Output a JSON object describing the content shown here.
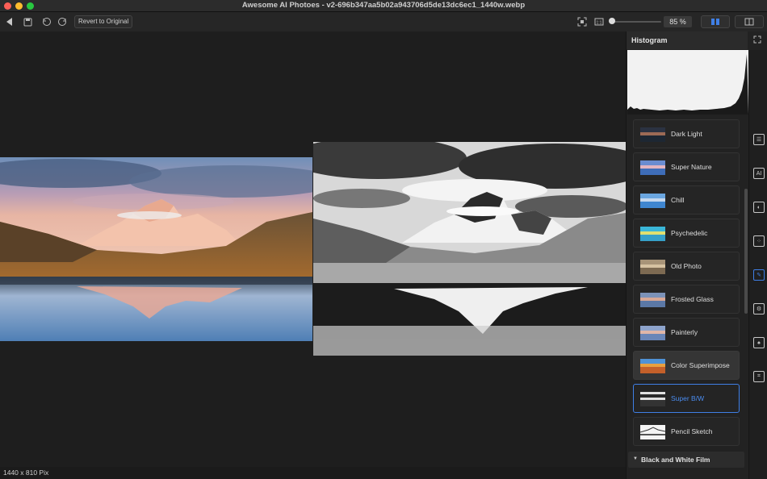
{
  "window": {
    "title": "Awesome AI Photoes   - v2-696b347aa5b02a943706d5de13dc6ec1_1440w.webp"
  },
  "toolbar": {
    "revert_label": "Revert to Original",
    "zoom_value": "85 %",
    "zoom_level": 0.85
  },
  "status": {
    "dimensions": "1440 x 810 Pix"
  },
  "histogram": {
    "title": "Histogram"
  },
  "presets": [
    {
      "label": "Dark Light",
      "icon": "thumb-dark-light"
    },
    {
      "label": "Super Nature",
      "icon": "thumb-super-nature"
    },
    {
      "label": "Chill",
      "icon": "thumb-chill"
    },
    {
      "label": "Psychedelic",
      "icon": "thumb-psychedelic"
    },
    {
      "label": "Old Photo",
      "icon": "thumb-old-photo"
    },
    {
      "label": "Frosted Glass",
      "icon": "thumb-frosted-glass"
    },
    {
      "label": "Painterly",
      "icon": "thumb-painterly"
    },
    {
      "label": "Color Superimpose",
      "icon": "thumb-color-superimpose"
    },
    {
      "label": "Super B/W",
      "icon": "thumb-super-bw"
    },
    {
      "label": "Pencil Sketch",
      "icon": "thumb-pencil-sketch"
    }
  ],
  "selected_preset": "Super B/W",
  "hovered_preset": "Color Superimpose",
  "section": {
    "label": "Black and White Film"
  },
  "side_tools": [
    "list-icon",
    "ai-icon",
    "tone-icon",
    "texture-icon",
    "filter-icon",
    "settings-icon",
    "mask-icon",
    "crop-icon"
  ],
  "colors": {
    "accent": "#3f7fe6",
    "background": "#1e1e1e",
    "panel": "#222222"
  }
}
